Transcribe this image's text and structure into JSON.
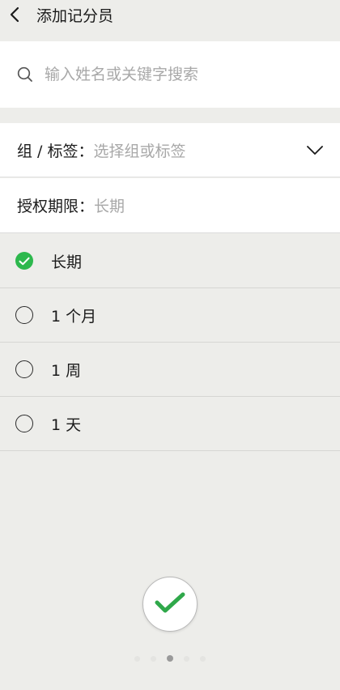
{
  "header": {
    "title": "添加记分员",
    "back_icon": "chevron-left-icon"
  },
  "search": {
    "placeholder": "输入姓名或关键字搜索",
    "value": "",
    "icon": "search-icon"
  },
  "group": {
    "label": "组 / 标签：",
    "placeholder": "选择组或标签",
    "icon": "chevron-down-icon"
  },
  "authorization": {
    "label": "授权期限：",
    "value": "长期"
  },
  "options": [
    {
      "label": "长期",
      "checked": true
    },
    {
      "label": "1 个月",
      "checked": false
    },
    {
      "label": "1 周",
      "checked": false
    },
    {
      "label": "1 天",
      "checked": false
    }
  ],
  "confirm": {
    "icon": "checkmark-icon"
  },
  "pager": {
    "count": 5,
    "active_index": 2
  },
  "colors": {
    "accent": "#2db84d",
    "background": "#ededea",
    "placeholder": "#a8a8a8"
  }
}
